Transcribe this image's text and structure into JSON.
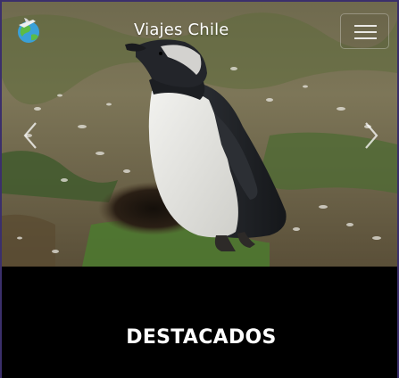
{
  "navbar": {
    "brand_title": "Viajes Chile",
    "logo_icon": "globe-plane-logo",
    "menu_icon": "hamburger-menu-icon"
  },
  "carousel": {
    "current_image_subject": "penguin",
    "prev_icon": "chevron-left-icon",
    "next_icon": "chevron-right-icon"
  },
  "featured": {
    "title": "DESTACADOS"
  },
  "colors": {
    "page_background": "#000000",
    "frame_border": "#3b2f6b",
    "text": "#ffffff"
  }
}
